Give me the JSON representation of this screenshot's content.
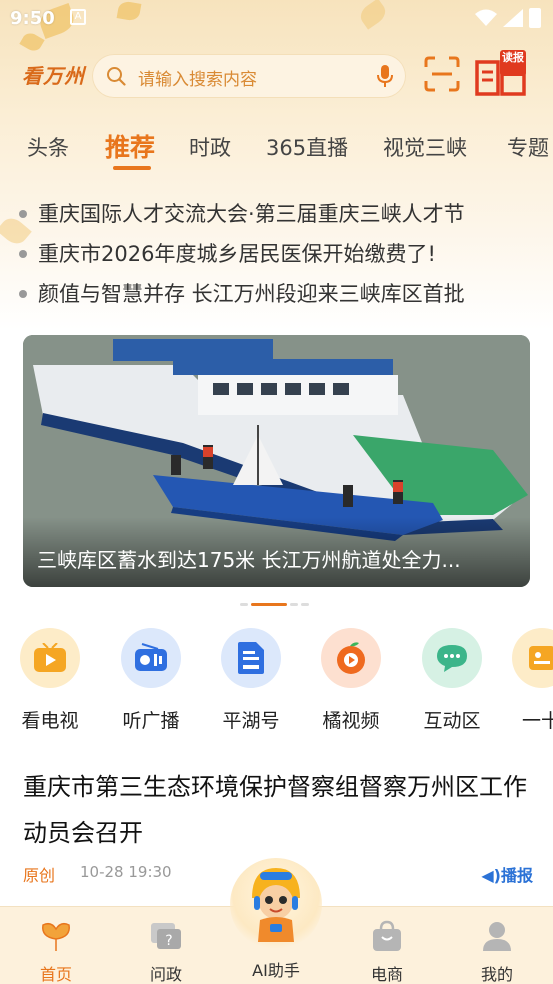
{
  "status": {
    "time": "9:50",
    "notification_glyph": "A"
  },
  "header": {
    "logo_text": "看万州",
    "search_placeholder": "请输入搜索内容",
    "read_badge": "读报"
  },
  "tabs": [
    {
      "label": "头条",
      "active": false
    },
    {
      "label": "推荐",
      "active": true
    },
    {
      "label": "时政",
      "active": false
    },
    {
      "label": "365直播",
      "active": false
    },
    {
      "label": "视觉三峡",
      "active": false
    },
    {
      "label": "专题",
      "active": false
    }
  ],
  "headlines": [
    "重庆国际人才交流大会·第三届重庆三峡人才节",
    "重庆市2026年度城乡居民医保开始缴费了!",
    "颜值与智慧并存 长江万州段迎来三峡库区首批"
  ],
  "banner": {
    "title": "三峡库区蓄水到达175米 长江万州航道处全力...",
    "slide_count": 4,
    "active_slide": 2
  },
  "shortcuts": [
    {
      "label": "看电视",
      "icon": "tv-icon",
      "color": "#f5a623"
    },
    {
      "label": "听广播",
      "icon": "radio-icon",
      "color": "#2f6fe0"
    },
    {
      "label": "平湖号",
      "icon": "document-icon",
      "color": "#2f6fe0"
    },
    {
      "label": "橘视频",
      "icon": "orange-video-icon",
      "color": "#ef6a1f"
    },
    {
      "label": "互动区",
      "icon": "chat-icon",
      "color": "#3cb58a"
    },
    {
      "label": "一十",
      "icon": "card-icon",
      "color": "#f5a623"
    }
  ],
  "article": {
    "title": "重庆市第三生态环境保护督察组督察万州区工作动员会召开",
    "source": "原创",
    "time": "10-28 19:30",
    "play_label": "播报"
  },
  "bottom_nav": [
    {
      "label": "首页",
      "icon": "home-leaf-icon",
      "active": true
    },
    {
      "label": "问政",
      "icon": "question-icon",
      "active": false
    },
    {
      "label": "AI助手",
      "icon": "ai-mascot-icon",
      "active": false
    },
    {
      "label": "电商",
      "icon": "shop-bag-icon",
      "active": false
    },
    {
      "label": "我的",
      "icon": "user-icon",
      "active": false
    }
  ],
  "colors": {
    "accent": "#e8761d",
    "link_blue": "#2b72d6"
  }
}
